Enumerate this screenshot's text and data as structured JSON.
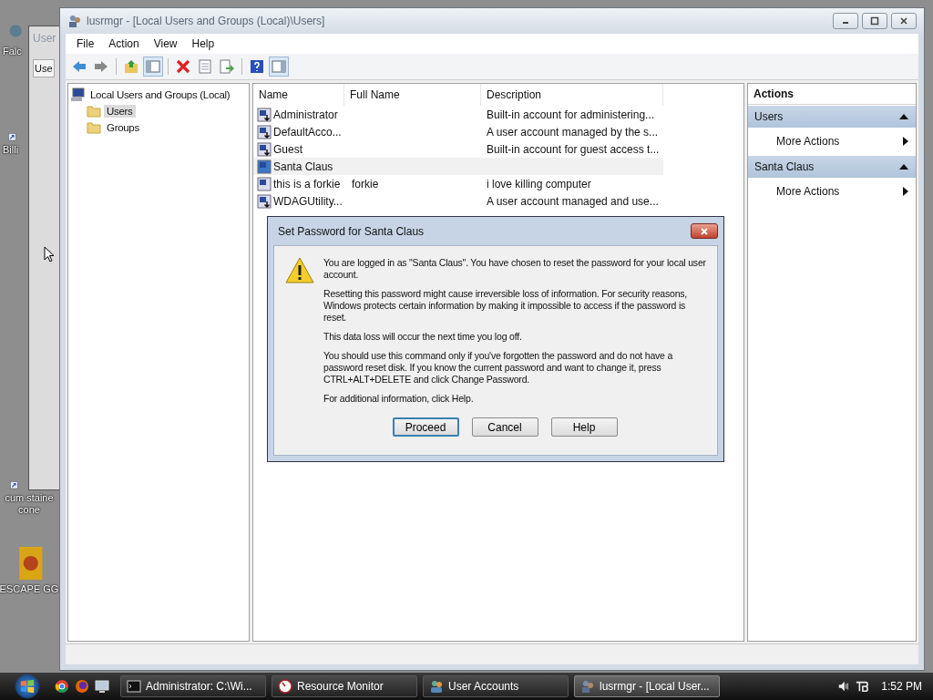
{
  "desktop_icons": [
    {
      "label": "Falc",
      "kind": "app"
    },
    {
      "label": "Billi",
      "kind": "shortcut"
    },
    {
      "label": "cum staine cone",
      "kind": "shortcut"
    },
    {
      "label": "ESCAPE GG",
      "kind": "box"
    }
  ],
  "background_window": {
    "title": "User",
    "tab": "Use"
  },
  "window": {
    "title": "lusrmgr - [Local Users and Groups (Local)\\Users]"
  },
  "menu": [
    "File",
    "Action",
    "View",
    "Help"
  ],
  "toolbar": [
    {
      "kind": "back",
      "pressed": false
    },
    {
      "kind": "forward",
      "pressed": false
    },
    {
      "kind": "up",
      "pressed": false
    },
    {
      "kind": "tree",
      "pressed": true
    },
    {
      "kind": "delete",
      "pressed": false
    },
    {
      "kind": "properties",
      "pressed": false
    },
    {
      "kind": "export",
      "pressed": false
    },
    {
      "kind": "help",
      "pressed": false
    },
    {
      "kind": "actionpane",
      "pressed": true
    }
  ],
  "tree": {
    "root": "Local Users and Groups (Local)",
    "children": [
      {
        "label": "Users",
        "selected": true
      },
      {
        "label": "Groups",
        "selected": false
      }
    ]
  },
  "table": {
    "columns": [
      "Name",
      "Full Name",
      "Description"
    ],
    "rows": [
      {
        "name": "Administrator",
        "full_name": "",
        "description": "Built-in account for administering...",
        "disabled": true,
        "selected": false
      },
      {
        "name": "DefaultAcco...",
        "full_name": "",
        "description": "A user account managed by the s...",
        "disabled": true,
        "selected": false
      },
      {
        "name": "Guest",
        "full_name": "",
        "description": "Built-in account for guest access t...",
        "disabled": true,
        "selected": false
      },
      {
        "name": "Santa Claus",
        "full_name": "",
        "description": "",
        "disabled": false,
        "selected": true
      },
      {
        "name": "this is a forkie",
        "full_name": "forkie",
        "description": "i love killing computer",
        "disabled": false,
        "selected": false
      },
      {
        "name": "WDAGUtility...",
        "full_name": "",
        "description": "A user account managed and use...",
        "disabled": true,
        "selected": false
      }
    ]
  },
  "actions": {
    "title": "Actions",
    "sections": [
      {
        "title": "Users",
        "expanded": true,
        "items": [
          "More Actions"
        ]
      },
      {
        "title": "Santa Claus",
        "expanded": true,
        "items": [
          "More Actions"
        ]
      }
    ]
  },
  "dialog": {
    "title": "Set Password for Santa Claus",
    "paragraphs": [
      "You are logged in as \"Santa Claus\". You have chosen to reset the password for your local user account.",
      "Resetting this password might cause irreversible loss of information. For security reasons, Windows protects certain information by making it impossible to access if the password is reset.",
      "This data loss will occur the next time you log off.",
      "You should use this command only if you've forgotten the password and do not have a password reset disk. If you know the current password and want to change it, press CTRL+ALT+DELETE and click Change Password.",
      "For additional information, click Help."
    ],
    "buttons": [
      {
        "label": "Proceed",
        "default": true
      },
      {
        "label": "Cancel",
        "default": false
      },
      {
        "label": "Help",
        "default": false
      }
    ]
  },
  "taskbar": {
    "quick_launch": [
      {
        "kind": "chrome"
      },
      {
        "kind": "firefox"
      },
      {
        "kind": "desktop"
      }
    ],
    "tasks": [
      {
        "label": "Administrator: C:\\Wi...",
        "kind": "cmd",
        "selected": false
      },
      {
        "label": "Resource Monitor",
        "kind": "monitor",
        "selected": false
      },
      {
        "label": "User Accounts",
        "kind": "users",
        "selected": false
      },
      {
        "label": "lusrmgr - [Local User...",
        "kind": "lusr",
        "selected": true
      }
    ],
    "clock": "1:52 PM"
  }
}
